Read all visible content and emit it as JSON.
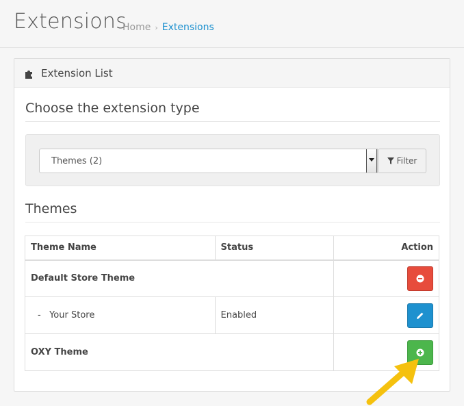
{
  "header": {
    "title": "Extensions",
    "breadcrumb": [
      {
        "label": "Home"
      },
      {
        "label": "Extensions"
      }
    ],
    "breadcrumb_separator": "›"
  },
  "panel": {
    "heading_icon": "puzzle-icon",
    "title": "Extension List"
  },
  "extension_type": {
    "section_title": "Choose the extension type",
    "selected_value": "Themes (2)",
    "filter_label": "Filter",
    "filter_icon": "filter-icon"
  },
  "themes": {
    "section_title": "Themes",
    "columns": [
      "Theme Name",
      "Status",
      "Action"
    ],
    "rows": [
      {
        "name": "Default Store Theme",
        "status": "",
        "action": "uninstall",
        "action_icon": "minus-circle-icon"
      },
      {
        "name": "-   Your Store",
        "status": "Enabled",
        "action": "edit",
        "action_icon": "pencil-icon"
      },
      {
        "name": "OXY Theme",
        "status": "",
        "action": "install",
        "action_icon": "plus-circle-icon"
      }
    ]
  },
  "colors": {
    "link": "#1e91cf",
    "danger": "#e74c3c",
    "primary": "#1e91cf",
    "success": "#4cb64c",
    "annotation_arrow": "#f5c10e"
  }
}
